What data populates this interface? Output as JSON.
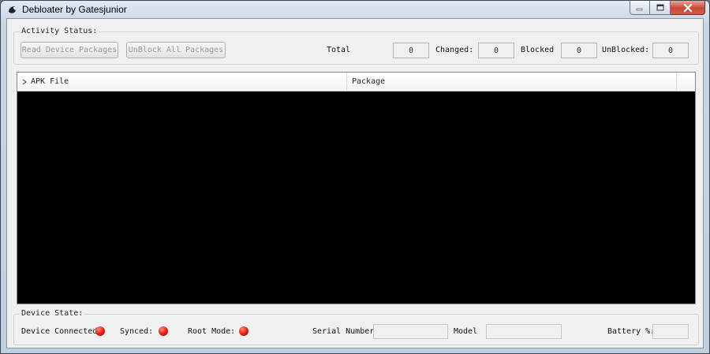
{
  "window": {
    "title": "Debloater by Gatesjunior",
    "controls": {
      "minimize": "minimize",
      "maximize": "maximize",
      "close": "close"
    }
  },
  "activity": {
    "group_label": "Activity Status:",
    "read_button": "Read Device Packages",
    "unblock_button": "UnBlock All Packages",
    "total_label": "Total",
    "total_value": "0",
    "changed_label": "Changed:",
    "changed_value": "0",
    "blocked_label": "Blocked",
    "blocked_value": "0",
    "unblocked_label": "UnBlocked:",
    "unblocked_value": "0"
  },
  "package_list": {
    "columns": [
      "APK File",
      "Package"
    ],
    "rows": []
  },
  "device_state": {
    "group_label": "Device State:",
    "connected_label": "Device Connected:",
    "synced_label": "Synced:",
    "root_label": "Root Mode:",
    "serial_label": "Serial Number:",
    "serial_value": "",
    "model_label": "Model",
    "model_value": "",
    "battery_label": "Battery %:",
    "battery_value": "",
    "indicator_color": "#e01b0f"
  }
}
